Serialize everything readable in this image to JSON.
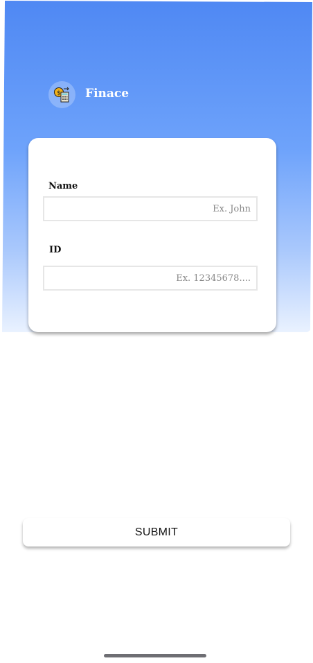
{
  "app": {
    "title": "Finace",
    "logo_icon": "coin-calculator-icon"
  },
  "form": {
    "name_label": "Name",
    "name_value": "",
    "name_placeholder": "Ex. John",
    "id_label": "ID",
    "id_value": "",
    "id_placeholder": "Ex. 12345678...."
  },
  "submit_label": "SUBMIT",
  "colors": {
    "header_top": "#4f88f3",
    "header_bottom": "#eaf2ff"
  }
}
